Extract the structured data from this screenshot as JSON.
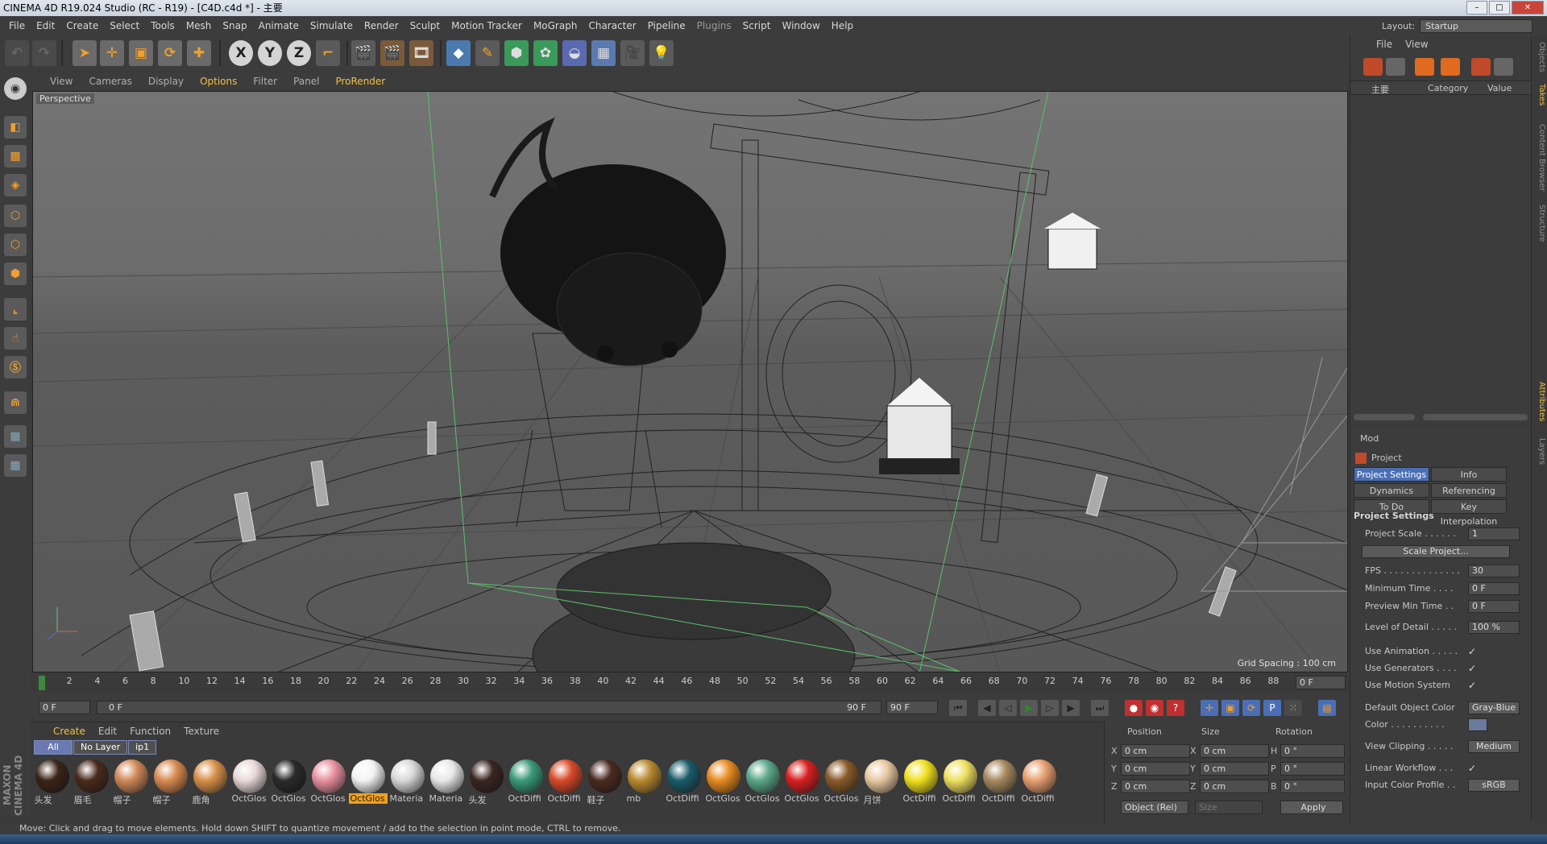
{
  "window": {
    "title": "CINEMA 4D R19.024 Studio (RC - R19) - [C4D.c4d *] - 主要"
  },
  "menubar": {
    "items": [
      "File",
      "Edit",
      "Create",
      "Select",
      "Tools",
      "Mesh",
      "Snap",
      "Animate",
      "Simulate",
      "Render",
      "Sculpt",
      "Motion Tracker",
      "MoGraph",
      "Character",
      "Pipeline",
      "Plugins",
      "Script",
      "Window",
      "Help"
    ]
  },
  "layout": {
    "label": "Layout:",
    "value": "Startup"
  },
  "toolbar": {
    "x_label": "X",
    "y_label": "Y",
    "z_label": "Z"
  },
  "viewport_menu": {
    "items": [
      "View",
      "Cameras",
      "Display",
      "Options",
      "Filter",
      "Panel",
      "ProRender"
    ]
  },
  "viewport": {
    "label": "Perspective",
    "grid_spacing": "Grid Spacing : 100 cm"
  },
  "timeline": {
    "ticks": [
      "0",
      "2",
      "4",
      "6",
      "8",
      "10",
      "12",
      "14",
      "16",
      "18",
      "20",
      "22",
      "24",
      "26",
      "28",
      "30",
      "32",
      "34",
      "36",
      "38",
      "40",
      "42",
      "44",
      "46",
      "48",
      "50",
      "52",
      "54",
      "56",
      "58",
      "60",
      "62",
      "64",
      "66",
      "68",
      "70",
      "72",
      "74",
      "76",
      "78",
      "80",
      "82",
      "84",
      "86",
      "88",
      "90"
    ],
    "current_frame": "0 F"
  },
  "transport": {
    "start": "0 F",
    "range_start": "0 F",
    "range_end": "90 F",
    "end": "90 F"
  },
  "materials": {
    "menu": [
      "Create",
      "Edit",
      "Function",
      "Texture"
    ],
    "filters": [
      "All",
      "No Layer",
      "ip1"
    ],
    "items": [
      {
        "label": "头发",
        "color": "#3a2418"
      },
      {
        "label": "眉毛",
        "color": "#4a2a1c"
      },
      {
        "label": "帽子",
        "color": "#d08858"
      },
      {
        "label": "帽子",
        "color": "#d88a50"
      },
      {
        "label": "鹿角",
        "color": "#d8904a"
      },
      {
        "label": "OctGlos",
        "color": "#e8d8d8"
      },
      {
        "label": "OctGlos",
        "color": "#2a2a2a"
      },
      {
        "label": "OctGlos",
        "color": "#e890a0"
      },
      {
        "label": "OctGlos",
        "color": "#f2f2f2",
        "selected": true
      },
      {
        "label": "Materia",
        "color": "#d8d8d8"
      },
      {
        "label": "Materia",
        "color": "#e8e8e8"
      },
      {
        "label": "头发",
        "color": "#3a2620"
      },
      {
        "label": "OctDiffi",
        "color": "#3a9a7a"
      },
      {
        "label": "OctDiffi",
        "color": "#d84a2a"
      },
      {
        "label": "鞋子",
        "color": "#4a2a20"
      },
      {
        "label": "mb",
        "color": "#b88a30"
      },
      {
        "label": "OctDiffi",
        "color": "#1a5a6a"
      },
      {
        "label": "OctGlos",
        "color": "#e88a20"
      },
      {
        "label": "OctGlos",
        "color": "#5aa88a"
      },
      {
        "label": "OctGlos",
        "color": "#d82020"
      },
      {
        "label": "OctGlos",
        "color": "#8a5a2a"
      },
      {
        "label": "月饼",
        "color": "#e8c8a0"
      },
      {
        "label": "OctDiffi",
        "color": "#f0e020"
      },
      {
        "label": "OctDiffi",
        "color": "#f0e060"
      },
      {
        "label": "OctDiffi",
        "color": "#a88a60"
      },
      {
        "label": "OctDiffi",
        "color": "#e8a070"
      }
    ]
  },
  "coords": {
    "headers": [
      "Position",
      "Size",
      "Rotation"
    ],
    "rows": [
      {
        "pl": "X",
        "pv": "0 cm",
        "sl": "X",
        "sv": "0 cm",
        "rl": "H",
        "rv": "0 °"
      },
      {
        "pl": "Y",
        "pv": "0 cm",
        "sl": "Y",
        "sv": "0 cm",
        "rl": "P",
        "rv": "0 °"
      },
      {
        "pl": "Z",
        "pv": "0 cm",
        "sl": "Z",
        "sv": "0 cm",
        "rl": "B",
        "rv": "0 °"
      }
    ],
    "mode": "Object (Rel)",
    "size_mode": "Size",
    "apply": "Apply"
  },
  "object_manager": {
    "menu": [
      "File",
      "View"
    ],
    "col_name": "主要",
    "col_category": "Category",
    "col_value": "Value"
  },
  "attributes": {
    "mode": "Mod",
    "title": "Project",
    "tabs": [
      "Project Settings",
      "Info",
      "Dynamics",
      "Referencing",
      "To Do",
      "Key Interpolation"
    ],
    "section": "Project Settings",
    "rows": [
      {
        "label": "Project Scale . . . . . .",
        "value": "1",
        "type": "field"
      },
      {
        "label": "",
        "value": "Scale Project...",
        "type": "wide"
      },
      {
        "label": "FPS . . . . . . . . . . . . . .",
        "value": "30",
        "type": "field"
      },
      {
        "label": "Minimum Time . . . .",
        "value": "0 F",
        "type": "field"
      },
      {
        "label": "Preview Min Time . .",
        "value": "0 F",
        "type": "field"
      },
      {
        "label": "Level of Detail . . . . .",
        "value": "100 %",
        "type": "field"
      },
      {
        "label": "Use Animation . . . . .",
        "value": "✓",
        "type": "check"
      },
      {
        "label": "Use Generators . . . .",
        "value": "✓",
        "type": "check"
      },
      {
        "label": "Use Motion System",
        "value": "✓",
        "type": "check"
      },
      {
        "label": "Default Object Color",
        "value": "Gray-Blue",
        "type": "button"
      },
      {
        "label": "Color . . . . . . . . . .",
        "value": "",
        "type": "swatch"
      },
      {
        "label": "View Clipping . . . . .",
        "value": "Medium",
        "type": "button"
      },
      {
        "label": "Linear Workflow . . .",
        "value": "✓",
        "type": "check"
      },
      {
        "label": "Input Color Profile . .",
        "value": "sRGB",
        "type": "button"
      }
    ]
  },
  "side_tabs": [
    "Objects",
    "Takes",
    "Content Browser",
    "Structure",
    "Attributes",
    "Layers"
  ],
  "status": {
    "text": "Move: Click and drag to move elements. Hold down SHIFT to quantize movement / add to the selection in point mode, CTRL to remove."
  },
  "logo": {
    "text": "MAXON CINEMA 4D"
  },
  "colors": {
    "accent": "#f0c040",
    "tab_active": "#4a6fb5",
    "bg": "#3c3c3c"
  }
}
